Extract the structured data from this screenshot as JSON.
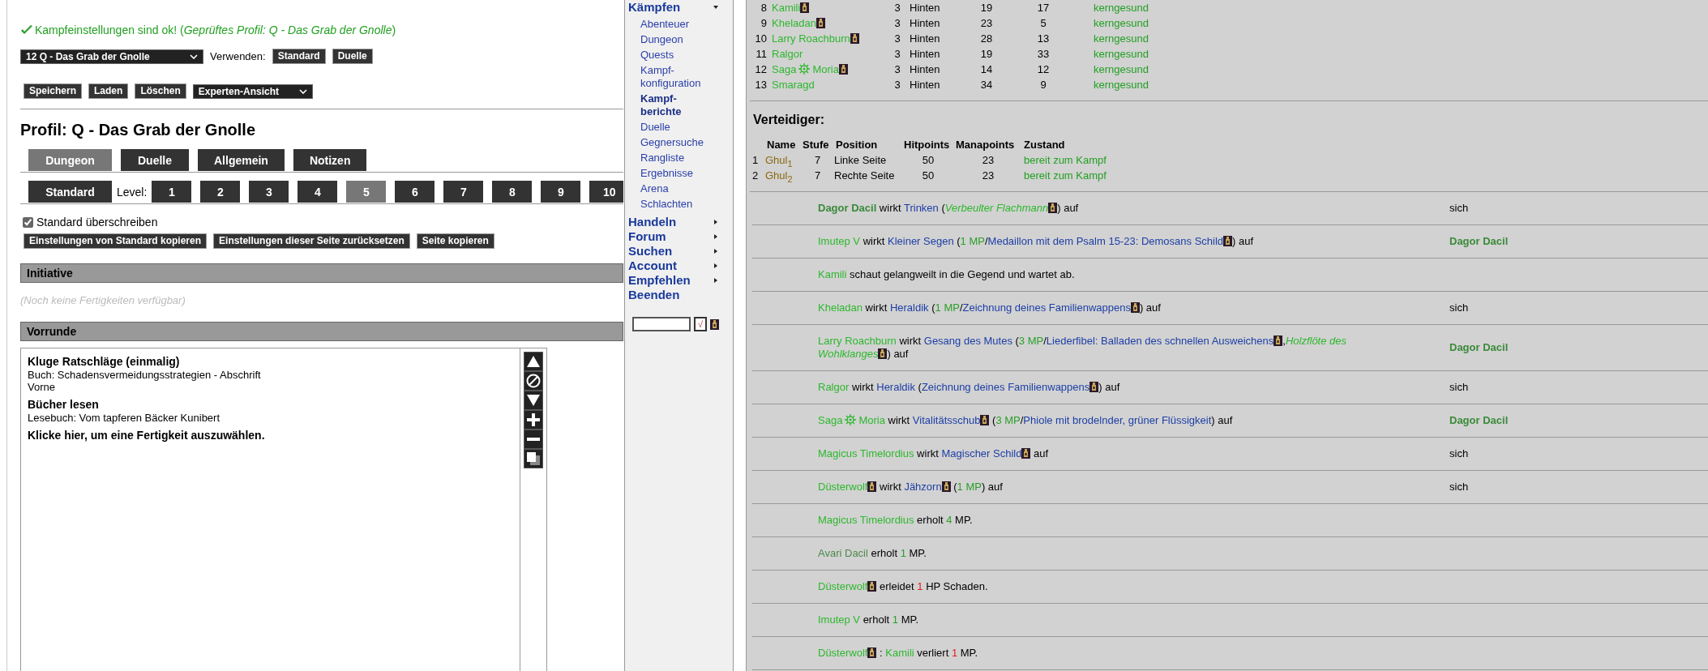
{
  "status": {
    "message": "Kampfeinstellungen sind ok! (*Geprüftes Profil: Q - Das Grab der Gnolle*)"
  },
  "profile_select": {
    "value": "12 Q - Das Grab der Gnolle"
  },
  "use_label": "Verwenden:",
  "use_buttons": [
    "Standard",
    "Duelle"
  ],
  "actions": [
    "Speichern",
    "Laden",
    "Löschen"
  ],
  "view_select": {
    "value": "Experten-Ansicht"
  },
  "profile_title": "Profil: Q - Das Grab der Gnolle",
  "tabs": [
    {
      "label": "Dungeon",
      "selected": true
    },
    {
      "label": "Duelle",
      "selected": false
    },
    {
      "label": "Allgemein",
      "selected": false
    },
    {
      "label": "Notizen",
      "selected": false
    }
  ],
  "standard_button": {
    "label": "Standard",
    "selected": false
  },
  "level_label": "Level:",
  "levels": [
    {
      "label": "1",
      "selected": false
    },
    {
      "label": "2",
      "selected": false
    },
    {
      "label": "3",
      "selected": false
    },
    {
      "label": "4",
      "selected": false
    },
    {
      "label": "5",
      "selected": true
    },
    {
      "label": "6",
      "selected": false
    },
    {
      "label": "7",
      "selected": false
    },
    {
      "label": "8",
      "selected": false
    },
    {
      "label": "9",
      "selected": false
    },
    {
      "label": "10",
      "selected": false
    }
  ],
  "override": {
    "label": "Standard überschreiben",
    "checked": true
  },
  "copy_buttons": [
    "Einstellungen von Standard kopieren",
    "Einstellungen dieser Seite zurücksetzen",
    "Seite kopieren"
  ],
  "sections": [
    {
      "kind": "empty",
      "title": "Initiative",
      "note": "(Noch keine Fertigkeiten verfügbar)"
    },
    {
      "kind": "list",
      "title": "Vorrunde",
      "entries": [
        {
          "title": "Kluge Ratschläge (einmalig)",
          "lines": [
            "Buch: Schadensvermeidungsstrategien - Abschrift",
            "Vorne"
          ]
        },
        {
          "title": "Bücher lesen",
          "lines": [
            "Lesebuch: Vom tapferen Bäcker Kunibert"
          ]
        }
      ],
      "prompt": "Klicke hier, um eine Fertigkeit auszuwählen.",
      "tools": [
        {
          "kind": "up"
        },
        {
          "kind": "block"
        },
        {
          "kind": "down"
        },
        {
          "kind": "plus"
        },
        {
          "kind": "minus"
        },
        {
          "kind": "copy"
        }
      ]
    }
  ],
  "nav": {
    "items": [
      {
        "label": "Kämpfen",
        "has_submenu": true,
        "expanded": true,
        "children": [
          {
            "label": "Abenteuer",
            "selected": false
          },
          {
            "label": "Dungeon",
            "selected": false
          },
          {
            "label": "Quests",
            "selected": false
          },
          {
            "label": "Kampf-konfiguration",
            "selected": false
          },
          {
            "label": "Kampf-berichte",
            "selected": true
          },
          {
            "label": "Duelle",
            "selected": false
          },
          {
            "label": "Gegnersuche",
            "selected": false
          },
          {
            "label": "Rangliste",
            "selected": false
          },
          {
            "label": "Ergebnisse",
            "selected": false
          },
          {
            "label": "Arena",
            "selected": false
          },
          {
            "label": "Schlachten",
            "selected": false
          }
        ]
      },
      {
        "label": "Handeln",
        "has_submenu": true,
        "expanded": false
      },
      {
        "label": "Forum",
        "has_submenu": true,
        "expanded": false
      },
      {
        "label": "Suchen",
        "has_submenu": true,
        "expanded": false
      },
      {
        "label": "Account",
        "has_submenu": true,
        "expanded": false
      },
      {
        "label": "Empfehlen",
        "has_submenu": true,
        "expanded": false
      },
      {
        "label": "Beenden",
        "has_submenu": false
      }
    ],
    "go_button": "√"
  },
  "attackers": [
    {
      "num": "8",
      "name": [
        {
          "kind": "char",
          "text": "Kamili"
        },
        {
          "kind": "icon"
        }
      ],
      "level": "3",
      "position": "Hinten",
      "hp": "19",
      "mp": "17",
      "state": "kerngesund"
    },
    {
      "num": "9",
      "name": [
        {
          "kind": "char",
          "text": "Kheladan"
        },
        {
          "kind": "icon"
        }
      ],
      "level": "3",
      "position": "Hinten",
      "hp": "23",
      "mp": "5",
      "state": "kerngesund"
    },
    {
      "num": "10",
      "name": [
        {
          "kind": "char",
          "text": "Larry Roachburn"
        },
        {
          "kind": "icon"
        }
      ],
      "level": "3",
      "position": "Hinten",
      "hp": "28",
      "mp": "13",
      "state": "kerngesund"
    },
    {
      "num": "11",
      "name": [
        {
          "kind": "char",
          "text": "Ralgor"
        }
      ],
      "level": "3",
      "position": "Hinten",
      "hp": "19",
      "mp": "33",
      "state": "kerngesund"
    },
    {
      "num": "12",
      "name": [
        {
          "kind": "char",
          "text": "Saga"
        },
        {
          "kind": "emblem"
        },
        {
          "kind": "char",
          "text": "Moria"
        },
        {
          "kind": "icon"
        }
      ],
      "level": "3",
      "position": "Hinten",
      "hp": "14",
      "mp": "12",
      "state": "kerngesund"
    },
    {
      "num": "13",
      "name": [
        {
          "kind": "char",
          "text": "Smaragd"
        }
      ],
      "level": "3",
      "position": "Hinten",
      "hp": "34",
      "mp": "9",
      "state": "kerngesund"
    }
  ],
  "defenders": {
    "title": "Verteidiger:",
    "columns": [
      "Name",
      "Stufe",
      "Position",
      "Hitpoints",
      "Manapoints",
      "Zustand"
    ],
    "rows": [
      {
        "num": "1",
        "name": "Ghul$_{1}$",
        "level": "7",
        "position": "Linke Seite",
        "hp": "50",
        "mp": "23",
        "state": "bereit zum Kampf"
      },
      {
        "num": "2",
        "name": "Ghul$_{2}$",
        "level": "7",
        "position": "Rechte Seite",
        "hp": "50",
        "mp": "23",
        "state": "bereit zum Kampf"
      }
    ]
  },
  "log": [
    {
      "parts": [
        {
          "kind": "hero",
          "text": "Dagor Dacil"
        },
        {
          "kind": "text",
          "text": " wirkt "
        },
        {
          "kind": "skill",
          "text": "Trinken"
        },
        {
          "kind": "text",
          "text": " ("
        },
        {
          "kind": "gear",
          "text": "Verbeulter Flachmann"
        },
        {
          "kind": "icon"
        },
        {
          "kind": "text",
          "text": ") auf"
        }
      ],
      "target": {
        "kind": "text",
        "text": "sich"
      }
    },
    {
      "parts": [
        {
          "kind": "char",
          "text": "Imutep V"
        },
        {
          "kind": "text",
          "text": " wirkt "
        },
        {
          "kind": "skill",
          "text": "Kleiner Segen"
        },
        {
          "kind": "text",
          "text": " ("
        },
        {
          "kind": "mp",
          "text": "1 MP"
        },
        {
          "kind": "text",
          "text": "/"
        },
        {
          "kind": "skill",
          "text": "Medaillon mit dem Psalm 15-23: Demosans Schild"
        },
        {
          "kind": "icon"
        },
        {
          "kind": "text",
          "text": ") auf"
        }
      ],
      "target": {
        "kind": "hero",
        "text": "Dagor Dacil"
      }
    },
    {
      "parts": [
        {
          "kind": "char",
          "text": "Kamili"
        },
        {
          "kind": "text",
          "text": " schaut gelangweilt in die Gegend und wartet ab."
        }
      ]
    },
    {
      "parts": [
        {
          "kind": "char",
          "text": "Kheladan"
        },
        {
          "kind": "text",
          "text": " wirkt "
        },
        {
          "kind": "skill",
          "text": "Heraldik"
        },
        {
          "kind": "text",
          "text": " ("
        },
        {
          "kind": "mp",
          "text": "1 MP"
        },
        {
          "kind": "text",
          "text": "/"
        },
        {
          "kind": "skill",
          "text": "Zeichnung deines Familienwappens"
        },
        {
          "kind": "icon"
        },
        {
          "kind": "text",
          "text": ") auf"
        }
      ],
      "target": {
        "kind": "text",
        "text": "sich"
      }
    },
    {
      "parts": [
        {
          "kind": "char",
          "text": "Larry Roachburn"
        },
        {
          "kind": "text",
          "text": " wirkt "
        },
        {
          "kind": "skill",
          "text": "Gesang des Mutes"
        },
        {
          "kind": "text",
          "text": " ("
        },
        {
          "kind": "mp",
          "text": "3 MP"
        },
        {
          "kind": "text",
          "text": "/"
        },
        {
          "kind": "skill",
          "text": "Liederfibel: Balladen des schnellen Ausweichens"
        },
        {
          "kind": "icon"
        },
        {
          "kind": "text",
          "text": ","
        },
        {
          "kind": "gear",
          "text": "Holzflöte des Wohlklanges"
        },
        {
          "kind": "icon"
        },
        {
          "kind": "text",
          "text": ") auf"
        }
      ],
      "target": {
        "kind": "hero",
        "text": "Dagor Dacil"
      }
    },
    {
      "parts": [
        {
          "kind": "char",
          "text": "Ralgor"
        },
        {
          "kind": "text",
          "text": " wirkt "
        },
        {
          "kind": "skill",
          "text": "Heraldik"
        },
        {
          "kind": "text",
          "text": " ("
        },
        {
          "kind": "skill",
          "text": "Zeichnung deines Familienwappens"
        },
        {
          "kind": "icon"
        },
        {
          "kind": "text",
          "text": ") auf"
        }
      ],
      "target": {
        "kind": "text",
        "text": "sich"
      }
    },
    {
      "parts": [
        {
          "kind": "char",
          "text": "Saga"
        },
        {
          "kind": "emblem"
        },
        {
          "kind": "char",
          "text": "Moria"
        },
        {
          "kind": "text",
          "text": " wirkt "
        },
        {
          "kind": "skill",
          "text": "Vitalitätsschub"
        },
        {
          "kind": "icon"
        },
        {
          "kind": "text",
          "text": " ("
        },
        {
          "kind": "mp",
          "text": "3 MP"
        },
        {
          "kind": "text",
          "text": "/"
        },
        {
          "kind": "skill",
          "text": "Phiole mit brodelnder, grüner Flüssigkeit"
        },
        {
          "kind": "text",
          "text": ") auf"
        }
      ],
      "target": {
        "kind": "hero",
        "text": "Dagor Dacil"
      }
    },
    {
      "parts": [
        {
          "kind": "char",
          "text": "Magicus Timelordius"
        },
        {
          "kind": "text",
          "text": " wirkt "
        },
        {
          "kind": "skill",
          "text": "Magischer Schild"
        },
        {
          "kind": "icon"
        },
        {
          "kind": "text",
          "text": " auf"
        }
      ],
      "target": {
        "kind": "text",
        "text": "sich"
      }
    },
    {
      "parts": [
        {
          "kind": "char",
          "text": "Düsterwolf"
        },
        {
          "kind": "icon"
        },
        {
          "kind": "text",
          "text": " wirkt "
        },
        {
          "kind": "skill",
          "text": "Jähzorn"
        },
        {
          "kind": "icon"
        },
        {
          "kind": "text",
          "text": " ("
        },
        {
          "kind": "mp",
          "text": "1 MP"
        },
        {
          "kind": "text",
          "text": ") auf"
        }
      ],
      "target": {
        "kind": "text",
        "text": "sich"
      }
    },
    {
      "parts": [
        {
          "kind": "char",
          "text": "Magicus Timelordius"
        },
        {
          "kind": "text",
          "text": " erholt "
        },
        {
          "kind": "mp",
          "text": "4"
        },
        {
          "kind": "text",
          "text": " MP."
        }
      ]
    },
    {
      "parts": [
        {
          "kind": "ally",
          "text": "Avari Dacil"
        },
        {
          "kind": "text",
          "text": " erholt "
        },
        {
          "kind": "mp",
          "text": "1"
        },
        {
          "kind": "text",
          "text": " MP."
        }
      ]
    },
    {
      "parts": [
        {
          "kind": "char",
          "text": "Düsterwolf"
        },
        {
          "kind": "icon"
        },
        {
          "kind": "text",
          "text": " erleidet "
        },
        {
          "kind": "dmg",
          "text": "1"
        },
        {
          "kind": "text",
          "text": " HP Schaden."
        }
      ]
    },
    {
      "parts": [
        {
          "kind": "char",
          "text": "Imutep V"
        },
        {
          "kind": "text",
          "text": " erholt "
        },
        {
          "kind": "mp",
          "text": "1"
        },
        {
          "kind": "text",
          "text": " MP."
        }
      ]
    },
    {
      "parts": [
        {
          "kind": "char",
          "text": "Düsterwolf"
        },
        {
          "kind": "icon"
        },
        {
          "kind": "text",
          "text": " : "
        },
        {
          "kind": "char",
          "text": "Kamili"
        },
        {
          "kind": "text",
          "text": " verliert "
        },
        {
          "kind": "dmg",
          "text": "1"
        },
        {
          "kind": "text",
          "text": " MP."
        }
      ]
    }
  ]
}
